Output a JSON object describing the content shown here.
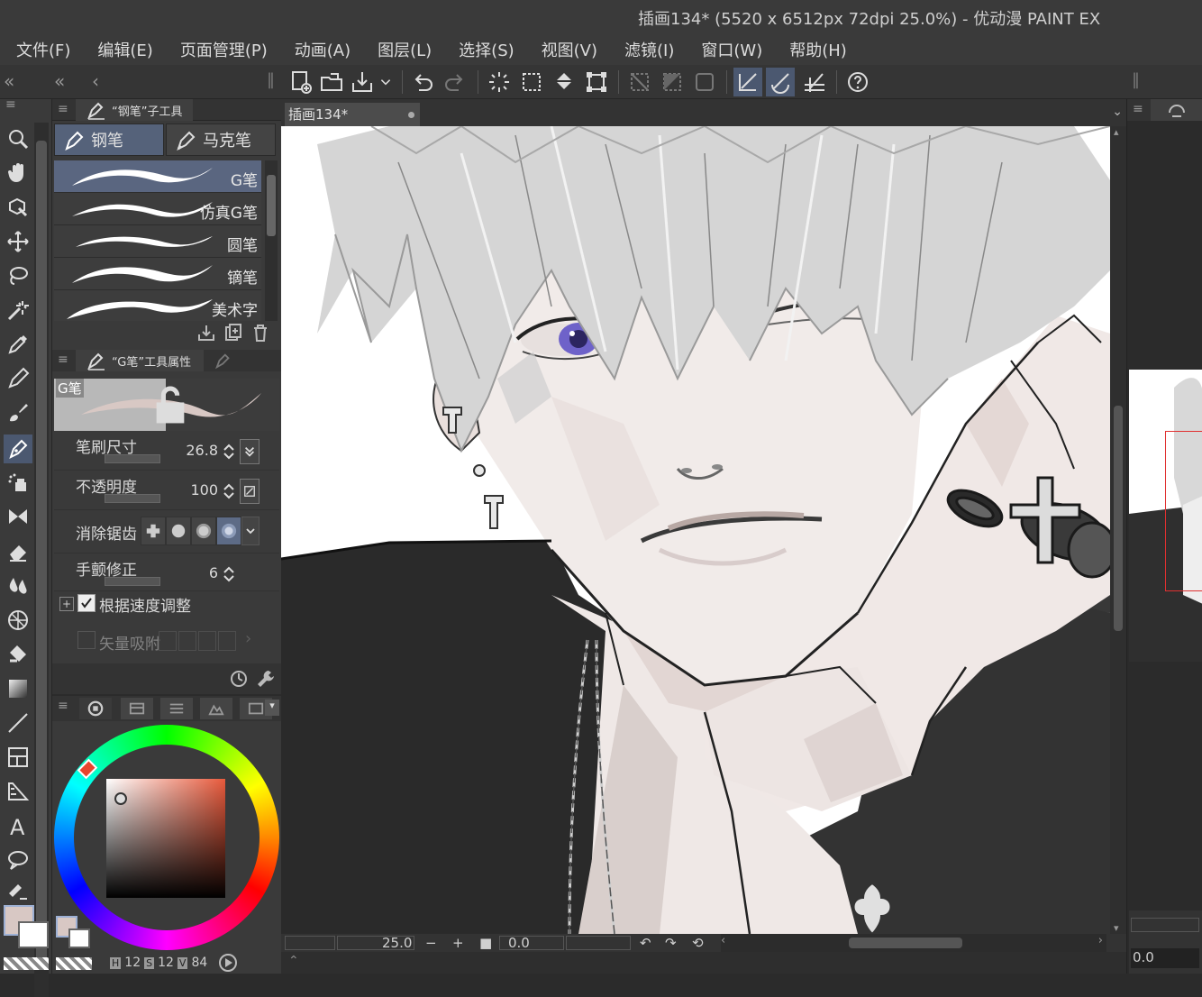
{
  "window": {
    "title": "插画134* (5520 x 6512px 72dpi 25.0%)  - 优动漫 PAINT EX"
  },
  "menu": [
    "文件(F)",
    "编辑(E)",
    "页面管理(P)",
    "动画(A)",
    "图层(L)",
    "选择(S)",
    "视图(V)",
    "滤镜(I)",
    "窗口(W)",
    "帮助(H)"
  ],
  "subtool": {
    "panel_title": "“钢笔”子工具",
    "groups": [
      "钢笔",
      "马克笔"
    ],
    "active_group": "钢笔",
    "brushes": [
      "G笔",
      "仿真G笔",
      "圆笔",
      "镝笔",
      "美术字"
    ],
    "selected_brush": "G笔"
  },
  "tool_property": {
    "panel_title": "“G笔”工具属性",
    "preview_label": "G笔",
    "brush_size_label": "笔刷尺寸",
    "brush_size_value": "26.8",
    "opacity_label": "不透明度",
    "opacity_value": "100",
    "antialias_label": "消除锯齿",
    "stabilization_label": "手颤修正",
    "stabilization_value": "6",
    "speed_adjust_label": "根据速度调整",
    "speed_adjust_checked": true,
    "vector_snap_label": "矢量吸附"
  },
  "color": {
    "hue": "12",
    "saturation": "12",
    "value": "84",
    "main_color": "#d8c8c4",
    "sub_color": "#ffffff",
    "hsv_labels": [
      "H",
      "S",
      "V"
    ]
  },
  "canvas": {
    "doc_tab": "插画134*",
    "zoom": "25.0",
    "rotation": "0.0"
  },
  "navigator": {
    "zoom": "0.0"
  },
  "colors": {
    "accent": "#4b5870",
    "panel_bg": "#3a3a3a",
    "selected_brush": "#5a6680"
  }
}
